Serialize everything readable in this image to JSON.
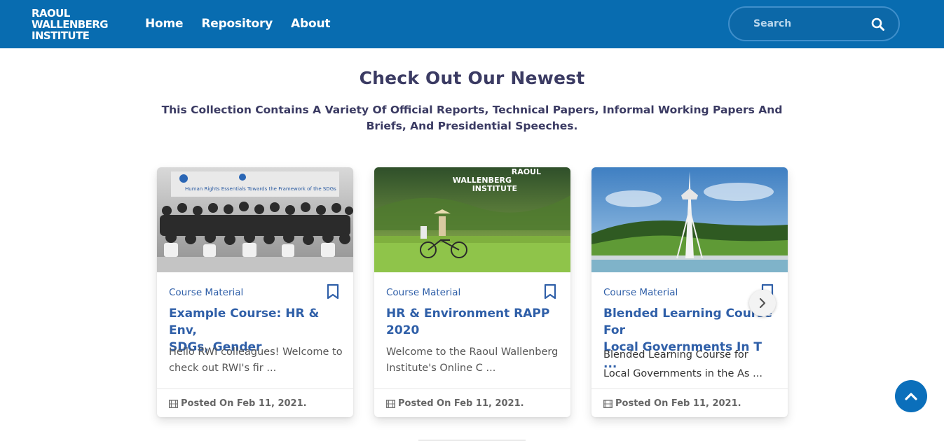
{
  "header": {
    "logo_lines": [
      "RAOUL",
      "WALLENBERG",
      "INSTITUTE"
    ],
    "nav": [
      {
        "label": "Home"
      },
      {
        "label": "Repository"
      },
      {
        "label": "About"
      }
    ],
    "search": {
      "placeholder": "Search",
      "icon": "search-icon"
    }
  },
  "main": {
    "title": "Check Out Our Newest",
    "subtitle": "This Collection Contains A Variety Of Official Reports, Technical Papers, Informal Working Papers And Briefs, And Presidential Speeches."
  },
  "cards": [
    {
      "category": "Course Material",
      "title": "Example Course: HR & Env,\nSDGs, Gender",
      "description": "Hello RWI colleagues! Welcome to\ncheck out RWI's fir ...",
      "date": "Posted On Feb 11, 2021.",
      "image": "group-photo",
      "image_text": "Human Rights Essentials Towards the Framework of the SDGs"
    },
    {
      "category": "Course Material",
      "title": "HR & Environment RAPP 2020",
      "description": "Welcome to the Raoul Wallenberg\nInstitute's Online C ...",
      "date": "Posted On Feb 11, 2021.",
      "image": "rice-field-cyclist",
      "image_text": "RAOUL\nWALLENBERG\nINSTITUTE"
    },
    {
      "category": "Course Material",
      "title": "Blended Learning Course For\nLocal Governments In T ...",
      "description": "Blended Learning Course for\nLocal Governments in the As ...",
      "date": "Posted On Feb 11, 2021.",
      "image": "memorial-tower"
    }
  ],
  "controls": {
    "next_icon": "chevron-right-icon",
    "scroll_top_icon": "chevron-up-icon"
  },
  "colors": {
    "header_bg": "#086cb0",
    "accent_text": "#2f5fa8",
    "heading_text": "#3b3b63",
    "scroll_top_bg": "#0b6fbb"
  }
}
